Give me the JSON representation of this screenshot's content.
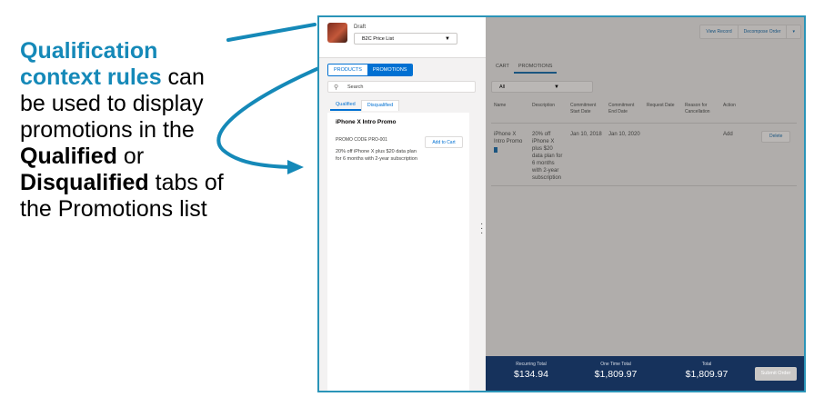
{
  "caption": {
    "line1_teal": "Qualification",
    "line2_teal": "context rules",
    "line2_rest": " can",
    "line3": "be used to display",
    "line4": "promotions in the",
    "line5_bold": "Qualified",
    "line5_rest": " or",
    "line6_bold": "Disqualified",
    "line6_rest": " tabs of",
    "line7": "the Promotions list"
  },
  "left": {
    "status": "Draft",
    "price_list": "B2C Price List",
    "tabs": {
      "products": "PRODUCTS",
      "promotions": "PROMOTIONS"
    },
    "search_placeholder": "Search",
    "subtabs": {
      "qualified": "Qualified",
      "disqualified": "Disqualified"
    },
    "promo": {
      "title": "iPhone X Intro Promo",
      "code": "PROMO CODE PRO-001",
      "description": "20% off iPhone X plus $20 data plan for 6 months with 2-year subscription",
      "add_label": "Add to Cart"
    }
  },
  "right": {
    "actions": {
      "view_record": "View Record",
      "decompose": "Decompose Order",
      "more": "▾"
    },
    "tabs": {
      "cart": "CART",
      "promotions": "PROMOTIONS"
    },
    "filter_value": "All",
    "table": {
      "headers": {
        "name": "Name",
        "description": "Description",
        "start": "Commitment Start Date",
        "end": "Commitment End Date",
        "request": "Request Date",
        "reason": "Reason for Cancellation",
        "action": "Action"
      },
      "row": {
        "name": "iPhone X Intro Promo",
        "description": "20% off iPhone X plus $20 data plan for 6 months with 2-year subscription",
        "start": "Jan 10, 2018",
        "end": "Jan 10, 2020",
        "request": "",
        "reason": "",
        "action": "Add",
        "delete_label": "Delete"
      }
    },
    "totals": {
      "recurring_label": "Recurring Total",
      "recurring_value": "$134.94",
      "onetime_label": "One Time Total",
      "onetime_value": "$1,809.97",
      "total_label": "Total",
      "total_value": "$1,809.97"
    },
    "submit_label": "Submit Order"
  },
  "colors": {
    "accent": "#1589b8",
    "brand": "#0070d2",
    "footer": "#16325c"
  }
}
